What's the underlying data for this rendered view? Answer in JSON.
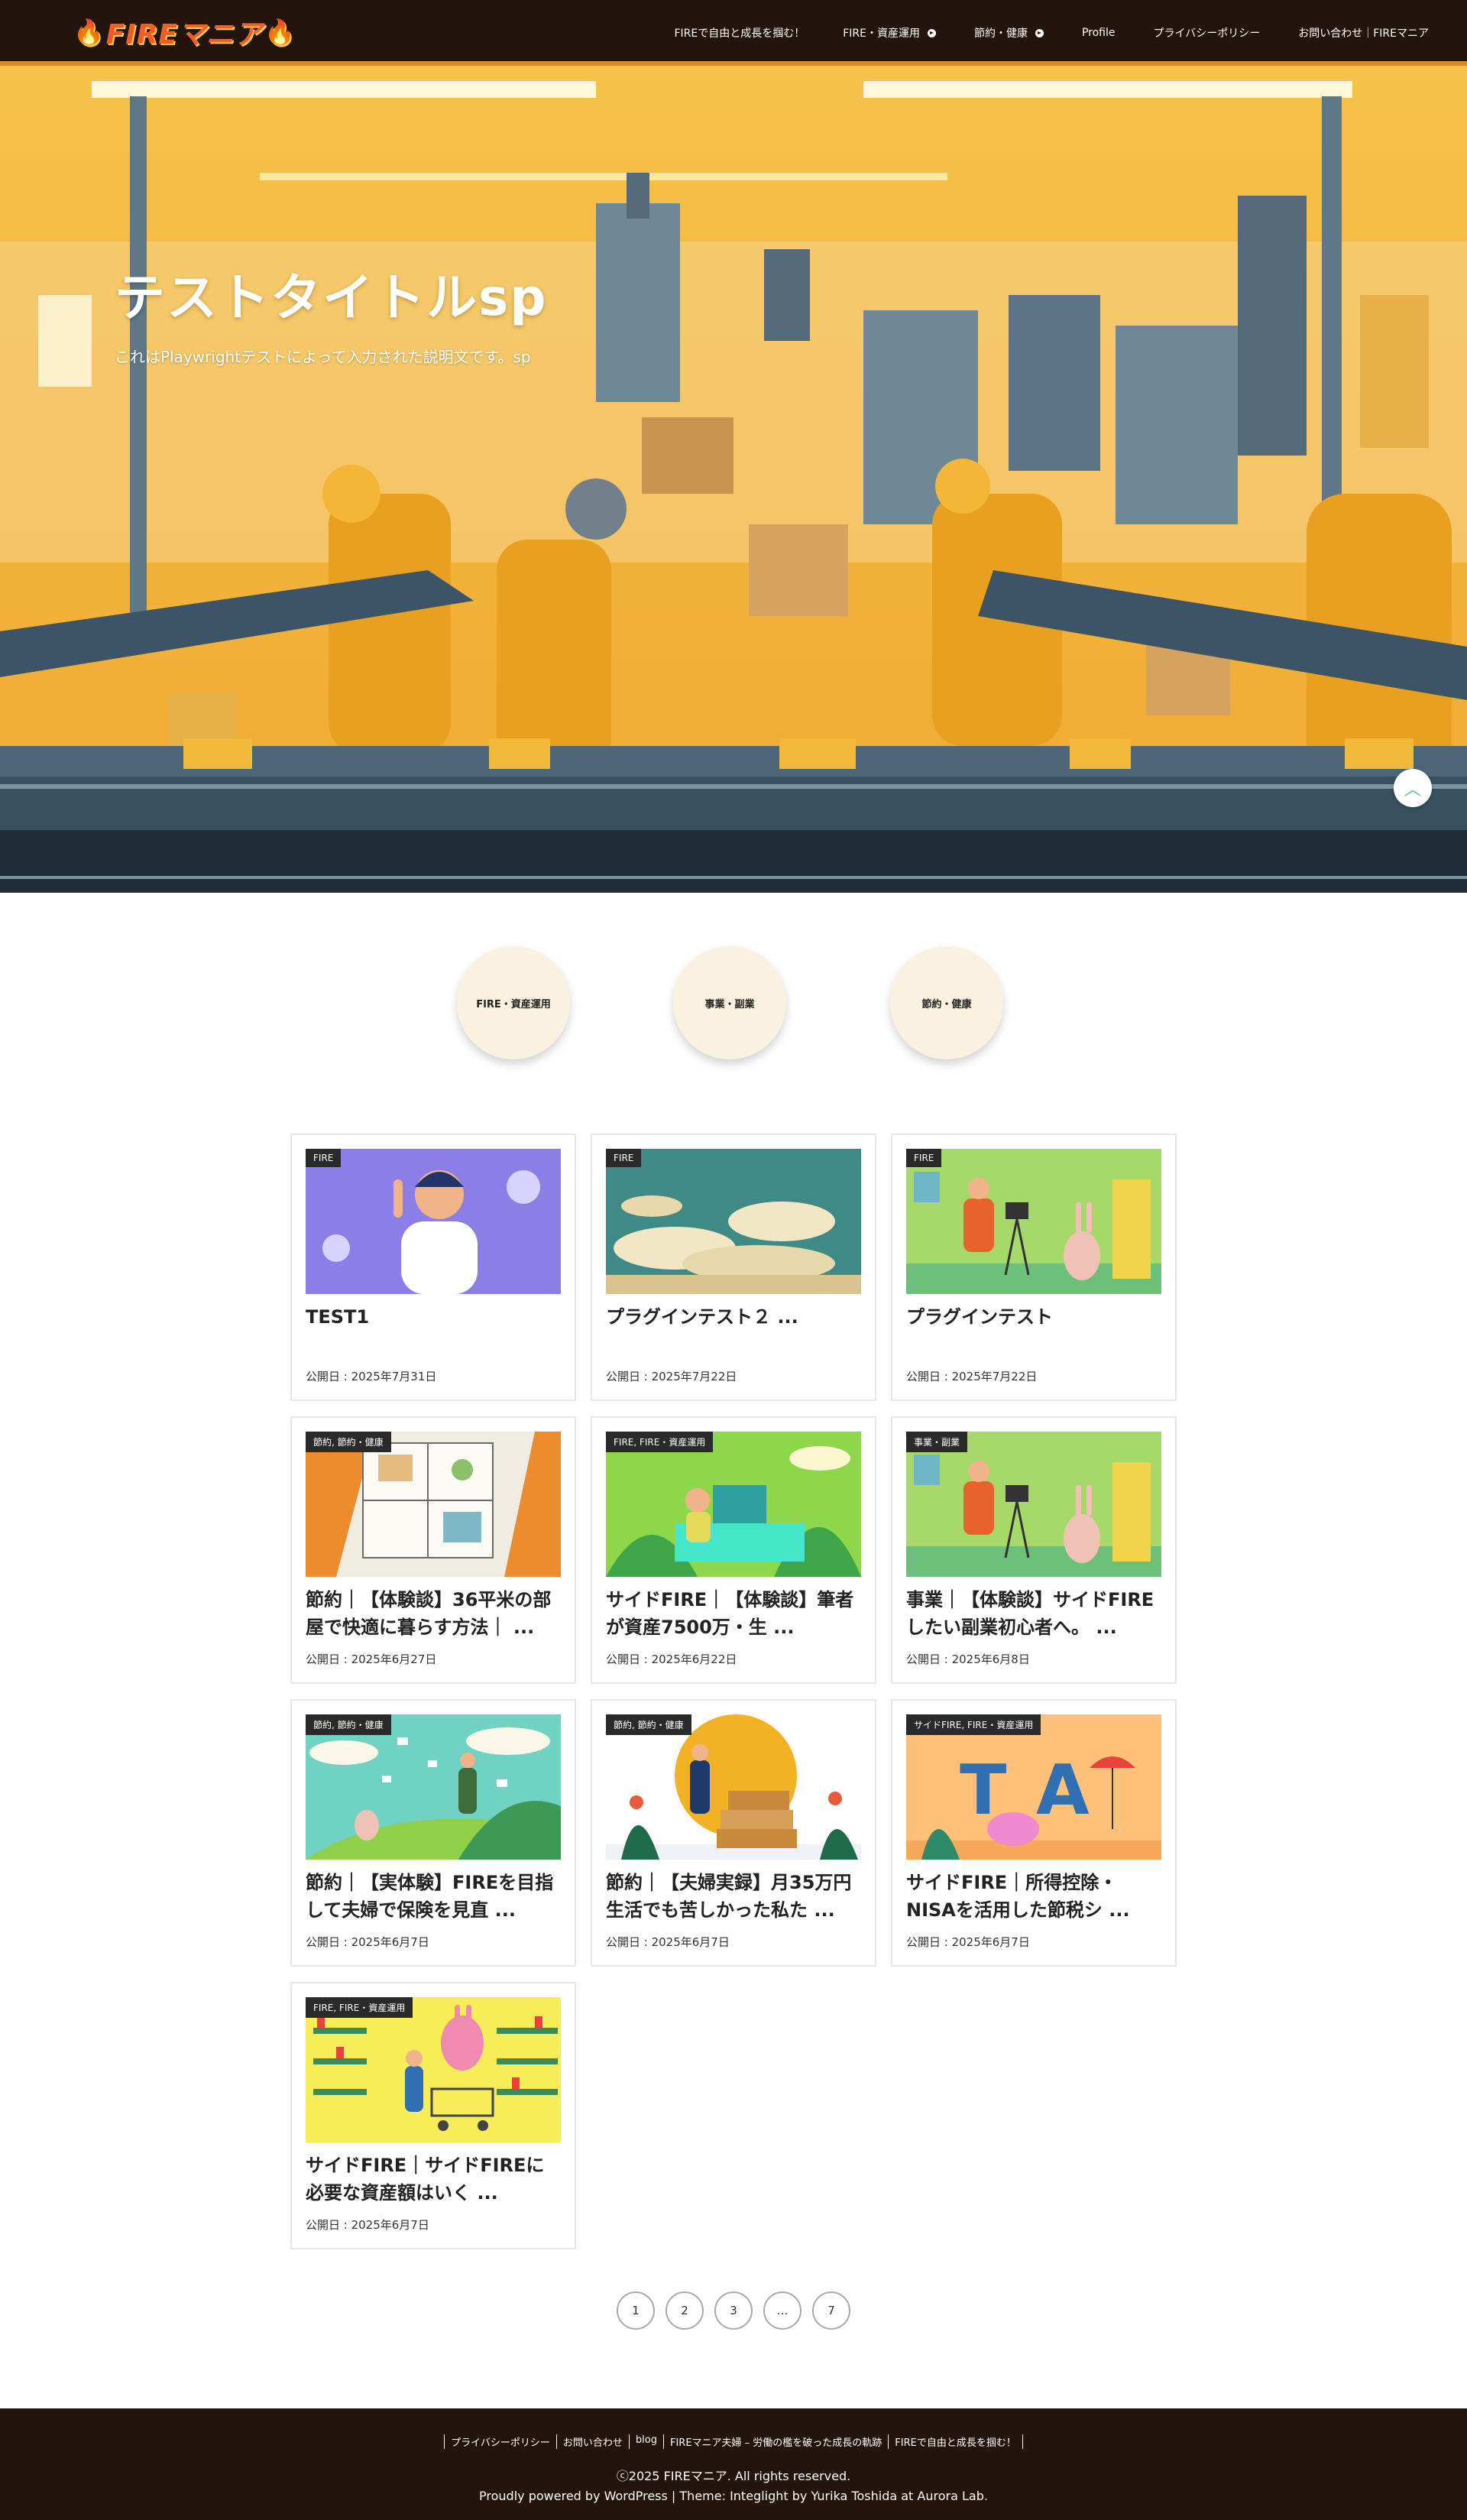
{
  "header": {
    "logo_text": "FIREマニア",
    "nav": [
      {
        "label": "FIREで自由と成長を掴む！",
        "dropdown": false
      },
      {
        "label": "FIRE・資産運用",
        "dropdown": true
      },
      {
        "label": "節約・健康",
        "dropdown": true
      },
      {
        "label": "Profile",
        "dropdown": false
      },
      {
        "label": "プライバシーポリシー",
        "dropdown": false
      },
      {
        "label": "お問い合わせ｜FIREマニア",
        "dropdown": false
      }
    ]
  },
  "hero": {
    "title": "テストタイトルsp",
    "description": "これはPlaywrightテストによって入力された説明文です。sp",
    "scroll_icon": "chevron-up-icon"
  },
  "categories": [
    {
      "label": "FIRE・資産運用"
    },
    {
      "label": "事業・副業"
    },
    {
      "label": "節約・健康"
    }
  ],
  "posts": [
    {
      "tag": "FIRE",
      "title": "TEST1",
      "date": "公開日 : 2025年7月31日"
    },
    {
      "tag": "FIRE",
      "title": "プラグインテスト２ ...",
      "date": "公開日 : 2025年7月22日"
    },
    {
      "tag": "FIRE",
      "title": "プラグインテスト",
      "date": "公開日 : 2025年7月22日"
    },
    {
      "tag": "節約, 節約・健康",
      "title": "節約｜【体験談】36平米の部屋で快適に暮らす方法｜ ...",
      "date": "公開日 : 2025年6月27日"
    },
    {
      "tag": "FIRE, FIRE・資産運用",
      "title": "サイドFIRE｜【体験談】筆者が資産7500万・生 ...",
      "date": "公開日 : 2025年6月22日"
    },
    {
      "tag": "事業・副業",
      "title": "事業｜【体験談】サイドFIREしたい副業初心者へ。 ...",
      "date": "公開日 : 2025年6月8日"
    },
    {
      "tag": "節約, 節約・健康",
      "title": "節約｜【実体験】FIREを目指して夫婦で保険を見直 ...",
      "date": "公開日 : 2025年6月7日"
    },
    {
      "tag": "節約, 節約・健康",
      "title": "節約｜【夫婦実録】月35万円生活でも苦しかった私た ...",
      "date": "公開日 : 2025年6月7日"
    },
    {
      "tag": "サイドFIRE, FIRE・資産運用",
      "title": "サイドFIRE｜所得控除・NISAを活用した節税シ ...",
      "date": "公開日 : 2025年6月7日"
    },
    {
      "tag": "FIRE, FIRE・資産運用",
      "title": "サイドFIRE｜サイドFIREに必要な資産額はいく ...",
      "date": "公開日 : 2025年6月7日"
    }
  ],
  "pagination": [
    "1",
    "2",
    "3",
    "…",
    "7"
  ],
  "footer": {
    "links": [
      "プライバシーポリシー",
      "お問い合わせ",
      "blog",
      "FIREマニア夫婦 – 労働の檻を破った成長の軌跡",
      "FIREで自由と成長を掴む！"
    ],
    "copyright": "ⓒ2025 FIREマニア. All rights reserved.",
    "credit": "Proudly powered by WordPress | Theme: Integlight by Yurika Toshida at Aurora Lab."
  },
  "colors": {
    "header_bg": "#23140d",
    "accent": "#d98a2b",
    "category_circle": "#fbf1e1",
    "footer_bg": "#23140d"
  }
}
